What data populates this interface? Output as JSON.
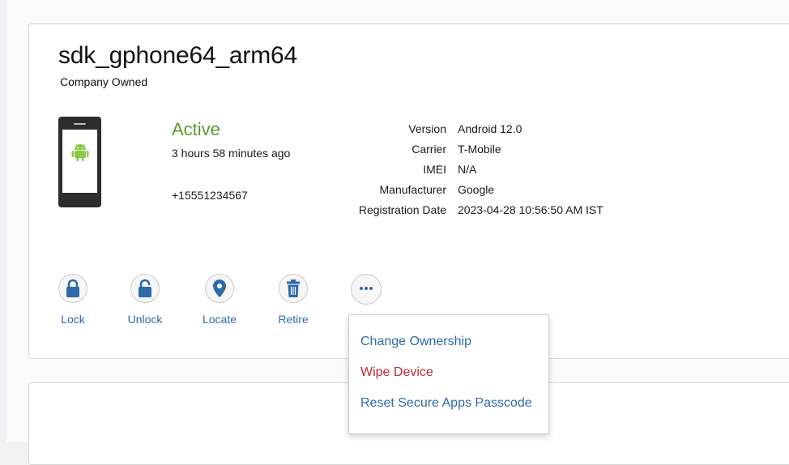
{
  "device": {
    "name": "sdk_gphone64_arm64",
    "ownership": "Company Owned",
    "status": "Active",
    "last_seen": "3 hours 58 minutes ago",
    "phone_number": "+15551234567",
    "icon": "android-phone-icon"
  },
  "details": [
    {
      "label": "Version",
      "value": "Android 12.0"
    },
    {
      "label": "Carrier",
      "value": "T-Mobile"
    },
    {
      "label": "IMEI",
      "value": "N/A"
    },
    {
      "label": "Manufacturer",
      "value": "Google"
    },
    {
      "label": "Registration Date",
      "value": "2023-04-28 10:56:50 AM IST"
    }
  ],
  "actions": [
    {
      "label": "Lock",
      "icon": "lock-icon"
    },
    {
      "label": "Unlock",
      "icon": "unlock-icon"
    },
    {
      "label": "Locate",
      "icon": "location-pin-icon"
    },
    {
      "label": "Retire",
      "icon": "trash-icon"
    }
  ],
  "more_menu": {
    "icon": "more-dots-icon",
    "items": [
      {
        "label": "Change Ownership",
        "color": "#2f6aa8"
      },
      {
        "label": "Wipe Device",
        "color": "#c0282d"
      },
      {
        "label": "Reset Secure Apps Passcode",
        "color": "#2f6aa8"
      }
    ]
  },
  "colors": {
    "active_status": "#5b9a2f",
    "link": "#2f6aa8",
    "danger": "#c0282d",
    "icon_blue": "#2f6aa8"
  }
}
